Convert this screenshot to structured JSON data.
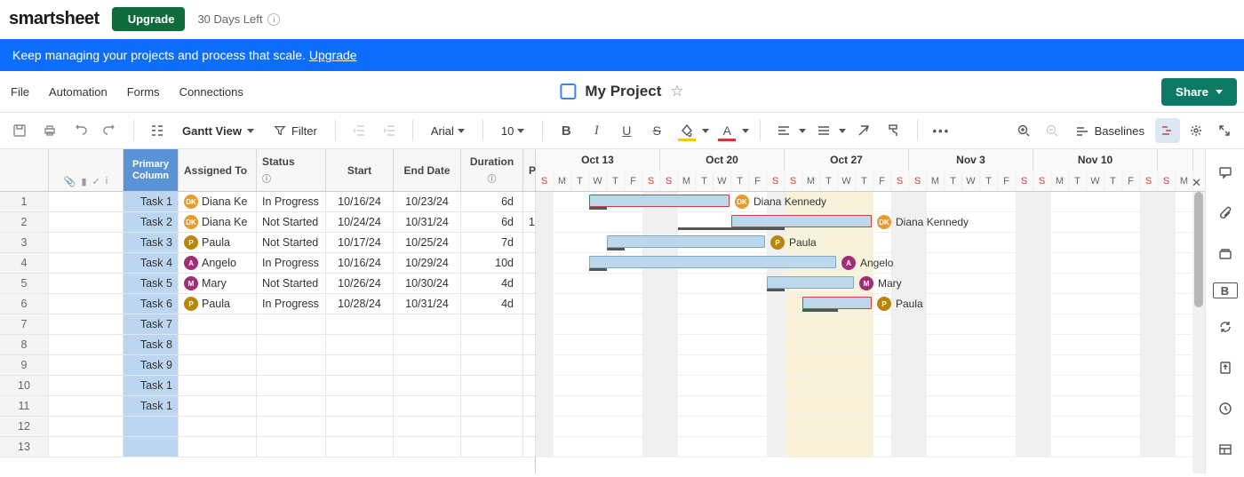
{
  "top": {
    "brand": "smartsheet",
    "upgrade": "Upgrade",
    "trial": "30 Days Left"
  },
  "banner": {
    "text": "Keep managing your projects and process that scale. ",
    "link": "Upgrade"
  },
  "menu": {
    "file": "File",
    "automation": "Automation",
    "forms": "Forms",
    "connections": "Connections"
  },
  "doc": {
    "title": "My Project"
  },
  "share": {
    "label": "Share"
  },
  "toolbar": {
    "view": "Gantt View",
    "filter": "Filter",
    "font": "Arial",
    "size": "10",
    "baselines": "Baselines"
  },
  "columns": {
    "primary": "Primary Column",
    "assigned": "Assigned To",
    "status": "Status",
    "start": "Start",
    "end": "End Date",
    "duration": "Duration",
    "p": "P"
  },
  "weeks": [
    "Oct 13",
    "Oct 20",
    "Oct 27",
    "Nov 3",
    "Nov 10"
  ],
  "dayLetters": [
    "S",
    "M",
    "T",
    "W",
    "T",
    "F",
    "S"
  ],
  "people": {
    "diana": {
      "initials": "DK",
      "name": "Diana Kennedy",
      "short": "Diana Ke",
      "color": "#e89a2b"
    },
    "paula": {
      "initials": "P",
      "name": "Paula",
      "short": "Paula",
      "color": "#b8860b"
    },
    "angelo": {
      "initials": "A",
      "name": "Angelo",
      "short": "Angelo",
      "color": "#a12d77"
    },
    "mary": {
      "initials": "M",
      "name": "Mary",
      "short": "Mary",
      "color": "#a12d77"
    }
  },
  "rows": [
    {
      "n": 1,
      "task": "Task 1",
      "who": "diana",
      "status": "In Progress",
      "start": "10/16/24",
      "end": "10/23/24",
      "dur": "6d",
      "p": "",
      "barStart": 3,
      "barLen": 8,
      "red": true,
      "base": [
        3,
        1
      ]
    },
    {
      "n": 2,
      "task": "Task 2",
      "who": "diana",
      "status": "Not Started",
      "start": "10/24/24",
      "end": "10/31/24",
      "dur": "6d",
      "p": "1",
      "barStart": 11,
      "barLen": 8,
      "red": true,
      "base": [
        8,
        6
      ]
    },
    {
      "n": 3,
      "task": "Task 3",
      "who": "paula",
      "status": "Not Started",
      "start": "10/17/24",
      "end": "10/25/24",
      "dur": "7d",
      "p": "",
      "barStart": 4,
      "barLen": 9,
      "red": false,
      "base": [
        4,
        1
      ]
    },
    {
      "n": 4,
      "task": "Task 4",
      "who": "angelo",
      "status": "In Progress",
      "start": "10/16/24",
      "end": "10/29/24",
      "dur": "10d",
      "p": "",
      "barStart": 3,
      "barLen": 14,
      "red": false,
      "base": [
        3,
        1
      ]
    },
    {
      "n": 5,
      "task": "Task 5",
      "who": "mary",
      "status": "Not Started",
      "start": "10/26/24",
      "end": "10/30/24",
      "dur": "4d",
      "p": "",
      "barStart": 13,
      "barLen": 5,
      "red": false,
      "base": [
        13,
        1
      ]
    },
    {
      "n": 6,
      "task": "Task 6",
      "who": "paula",
      "status": "In Progress",
      "start": "10/28/24",
      "end": "10/31/24",
      "dur": "4d",
      "p": "",
      "barStart": 15,
      "barLen": 4,
      "red": true,
      "base": [
        15,
        2
      ]
    },
    {
      "n": 7,
      "task": "Task 7"
    },
    {
      "n": 8,
      "task": "Task 8"
    },
    {
      "n": 9,
      "task": "Task 9"
    },
    {
      "n": 10,
      "task": "Task 1"
    },
    {
      "n": 11,
      "task": "Task 1"
    },
    {
      "n": 12,
      "task": ""
    },
    {
      "n": 13,
      "task": ""
    }
  ]
}
